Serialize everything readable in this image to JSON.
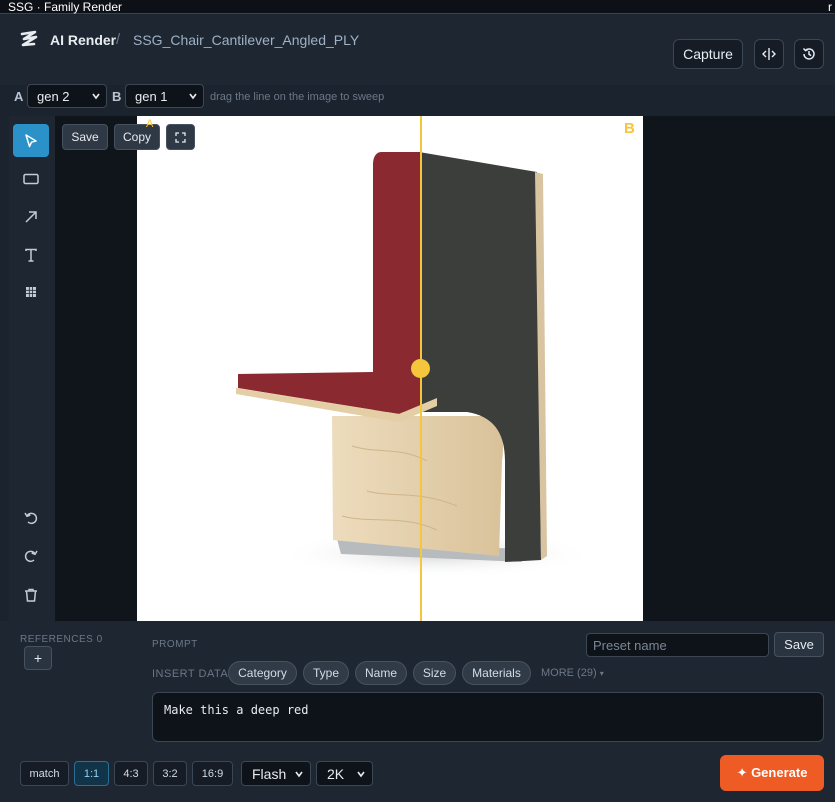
{
  "window": {
    "title": "SSG · Family Render",
    "corner_glyph": "r"
  },
  "header": {
    "app_name": "AI Render",
    "separator": "/",
    "breadcrumb": "SSG_Chair_Cantilever_Angled_PLY",
    "capture_label": "Capture",
    "logo_icon": "zigzag-logo-icon",
    "compare_icon": "split-compare-icon",
    "history_icon": "history-icon"
  },
  "compare": {
    "a_label": "A",
    "a_value": "gen 2",
    "b_label": "B",
    "b_value": "gen 1",
    "hint": "drag the line on the image to sweep",
    "sweep_position": 0.56,
    "accent": "#f5c53b"
  },
  "toolbar": {
    "tools": [
      "select-arrow-icon",
      "rectangle-icon",
      "arrow-icon",
      "text-icon",
      "grid-icon"
    ],
    "active_tool": "select-arrow-icon",
    "bottom_tools": [
      "undo-icon",
      "redo-icon",
      "trash-icon"
    ],
    "active_color": "#2a91c9"
  },
  "canvas": {
    "save_label": "Save",
    "copy_label": "Copy",
    "fullscreen_icon": "fullscreen-icon",
    "label_a": "A",
    "label_b": "B",
    "colors": {
      "seat_red": "#8a2a30",
      "back_gray": "#3a3d3a",
      "plywood": "#e7d3b0"
    }
  },
  "references": {
    "label": "REFERENCES 0",
    "add_label": "+"
  },
  "prompt": {
    "label": "PROMPT",
    "preset_placeholder": "Preset name",
    "preset_save_label": "Save",
    "insert_label": "INSERT DATA",
    "chips": [
      "Category",
      "Type",
      "Name",
      "Size",
      "Materials"
    ],
    "more_label": "MORE (29)",
    "text": "Make this a deep red"
  },
  "footer": {
    "ratios": [
      "match",
      "1:1",
      "4:3",
      "3:2",
      "16:9"
    ],
    "active_ratio": "1:1",
    "model": "Flash",
    "resolution": "2K",
    "generate_label": "✦ Generate",
    "generate_color": "#ef5b24"
  }
}
